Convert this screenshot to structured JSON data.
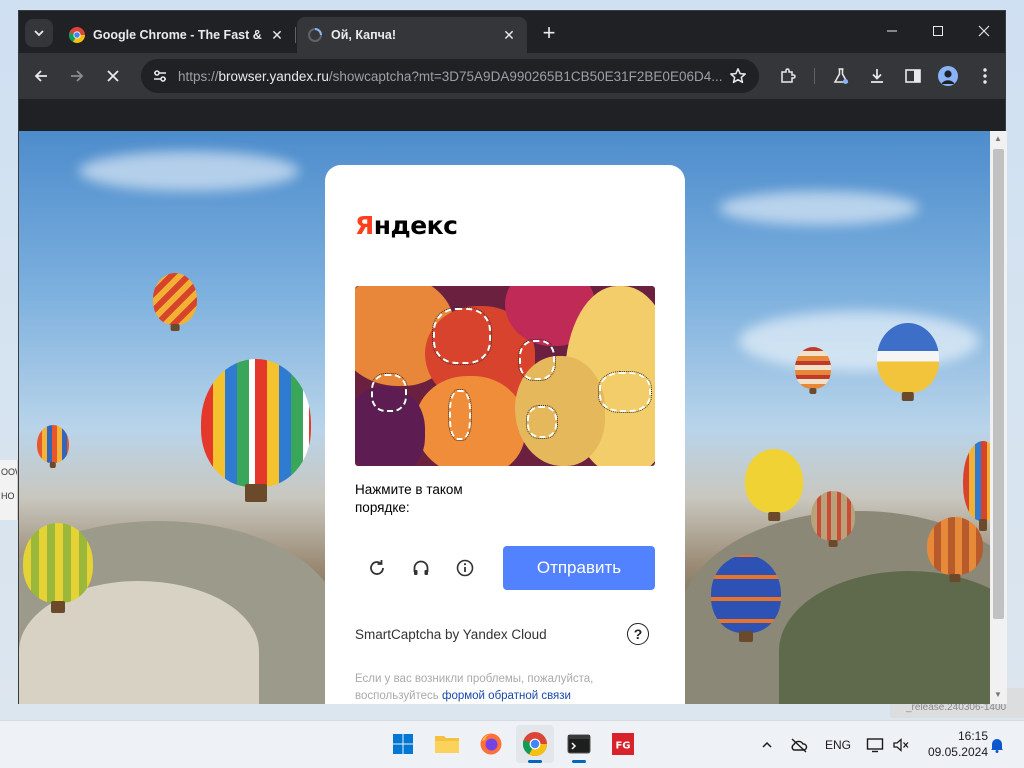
{
  "browser": {
    "tabs": [
      {
        "title": "Google Chrome - The Fast & Secure Web Browser Built to Have Fun",
        "icon": "chrome-icon"
      },
      {
        "title": "Ой, Капча!",
        "icon": "loading-spinner-icon"
      }
    ],
    "url_scheme": "https://",
    "url_host": "browser.yandex.ru",
    "url_path": "/showcaptcha?mt=3D75A9DA990265B1CB50E31F2BE0E06D4..."
  },
  "captcha": {
    "logo_first": "Я",
    "logo_rest": "ндекс",
    "instruction": "Нажмите в таком порядке:",
    "submit_label": "Отправить",
    "branding": "SmartCaptcha by Yandex Cloud",
    "help_label": "?",
    "footer_text": "Если у вас возникли проблемы, пожалуйста, воспользуйтесь",
    "footer_link": "формой обратной связи"
  },
  "desktop": {
    "left_snippet_1": "OOW",
    "left_snippet_2": "НО",
    "right_snippet": "_release.240306-1400"
  },
  "taskbar": {
    "apps": [
      "start-icon",
      "file-explorer-icon",
      "firefox-icon",
      "chrome-icon",
      "terminal-icon",
      "fg-app-icon"
    ],
    "language": "ENG",
    "time": "16:15",
    "date": "09.05.2024"
  },
  "colors": {
    "yandex_red": "#fc3f1d",
    "submit_blue": "#5282ff",
    "chrome_dark": "#202124"
  }
}
